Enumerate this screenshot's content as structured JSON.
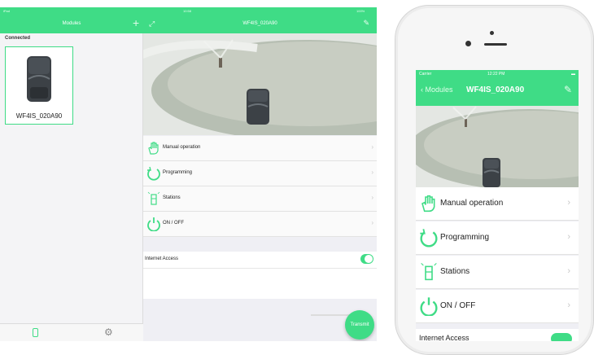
{
  "colors": {
    "accent": "#3fdc86",
    "background": "#efeff4",
    "chevron": "#c8c8c8"
  },
  "ipad": {
    "status": {
      "carrier": "iPad",
      "time": "10:58",
      "battery": "100%"
    },
    "sidebar": {
      "title": "Modules",
      "section_header": "Connected",
      "module_name": "WF4IS_020A90",
      "tab_icons": [
        "module-icon",
        "gear-icon"
      ]
    },
    "detail": {
      "title": "WF4IS_020A90",
      "menu": [
        {
          "label": "Manual operation",
          "icon": "hand-icon"
        },
        {
          "label": "Programming",
          "icon": "cycle-icon"
        },
        {
          "label": "Stations",
          "icon": "sprinkler-icon"
        },
        {
          "label": "ON / OFF",
          "icon": "power-icon"
        }
      ],
      "internet_label": "Internet Access",
      "internet_enabled": true,
      "transmit_label": "Transmit"
    }
  },
  "iphone": {
    "status": {
      "carrier": "Carrier",
      "time": "12:22 PM"
    },
    "nav": {
      "back_label": "Modules",
      "title": "WF4IS_020A90"
    },
    "menu": [
      {
        "label": "Manual operation",
        "icon": "hand-icon"
      },
      {
        "label": "Programming",
        "icon": "cycle-icon"
      },
      {
        "label": "Stations",
        "icon": "sprinkler-icon"
      },
      {
        "label": "ON / OFF",
        "icon": "power-icon"
      }
    ],
    "internet_label": "Internet Access",
    "internet_enabled": true
  }
}
